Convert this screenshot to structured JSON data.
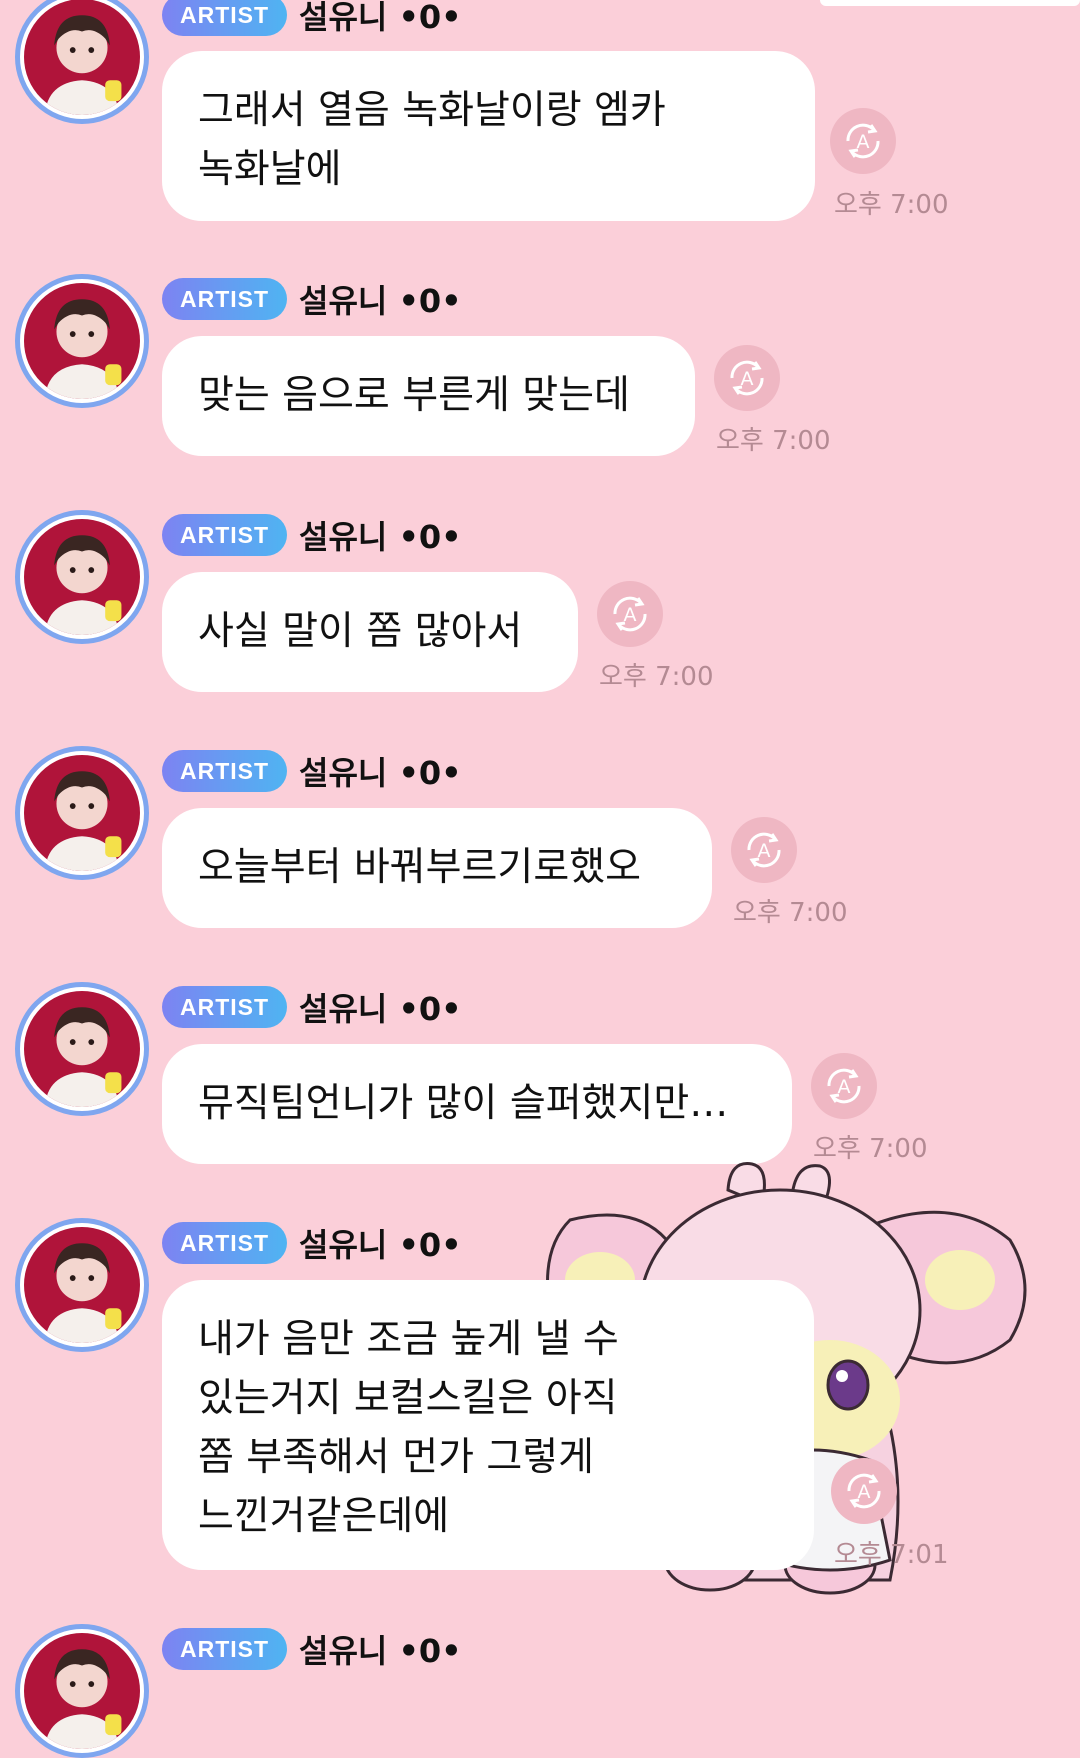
{
  "sender": {
    "badge": "ARTIST",
    "name": "설유니 •0•"
  },
  "messages": [
    {
      "text": "그래서 열음 녹화날이랑 엠카\n녹화날에",
      "time": "오후 7:00"
    },
    {
      "text": "맞는 음으로 부른게 맞는데",
      "time": "오후 7:00"
    },
    {
      "text": "사실 말이 쫌 많아서",
      "time": "오후 7:00"
    },
    {
      "text": "오늘부터 바꿔부르기로했오",
      "time": "오후 7:00"
    },
    {
      "text": "뮤직팀언니가 많이 슬퍼했지만…",
      "time": "오후 7:00"
    },
    {
      "text": "내가 음만 조금 높게 낼 수\n있는거지 보컬스킬은 아직\n쫌 부족해서 먼가 그렇게\n느낀거같은데에",
      "time": "오후 7:01"
    }
  ],
  "icons": {
    "translate": "translate-icon",
    "avatar": "profile-photo",
    "sticker": "pink-bunny-sticker"
  },
  "colors": {
    "background": "#fbcfd9",
    "bubble": "#ffffff",
    "badge_start": "#7d83f2",
    "badge_end": "#4fb4f2",
    "avatar_ring": "#7fa6ef",
    "time": "#b48a93",
    "translate_icon": "#efb7c3"
  }
}
